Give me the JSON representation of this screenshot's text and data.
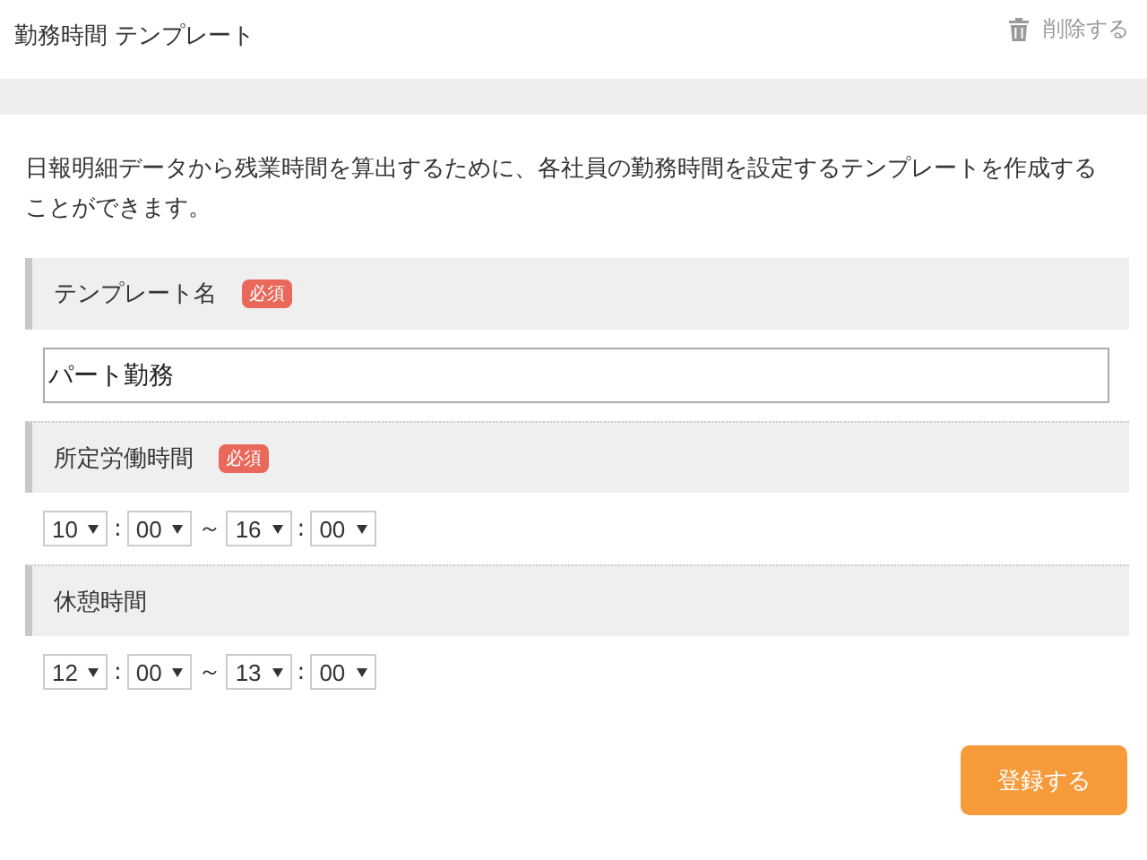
{
  "header": {
    "title": "勤務時間 テンプレート",
    "delete_label": "削除する"
  },
  "description": "日報明細データから残業時間を算出するために、各社員の勤務時間を設定するテンプレートを作成することができます。",
  "sections": [
    {
      "label": "テンプレート名",
      "badge": "必須",
      "kind": "text",
      "value": "パート勤務"
    },
    {
      "label": "所定労働時間",
      "badge": "必須",
      "kind": "time",
      "parts": [
        {
          "kind": "select",
          "value": "10"
        },
        {
          "kind": "sep",
          "value": ":"
        },
        {
          "kind": "select",
          "value": "00"
        },
        {
          "kind": "sep",
          "value": "～"
        },
        {
          "kind": "select",
          "value": "16"
        },
        {
          "kind": "sep",
          "value": ":"
        },
        {
          "kind": "select",
          "value": "00"
        }
      ]
    },
    {
      "label": "休憩時間",
      "kind": "time",
      "parts": [
        {
          "kind": "select",
          "value": "12"
        },
        {
          "kind": "sep",
          "value": ":"
        },
        {
          "kind": "select",
          "value": "00"
        },
        {
          "kind": "sep",
          "value": "～"
        },
        {
          "kind": "select",
          "value": "13"
        },
        {
          "kind": "sep",
          "value": ":"
        },
        {
          "kind": "select",
          "value": "00"
        }
      ]
    }
  ],
  "submit_label": "登録する"
}
